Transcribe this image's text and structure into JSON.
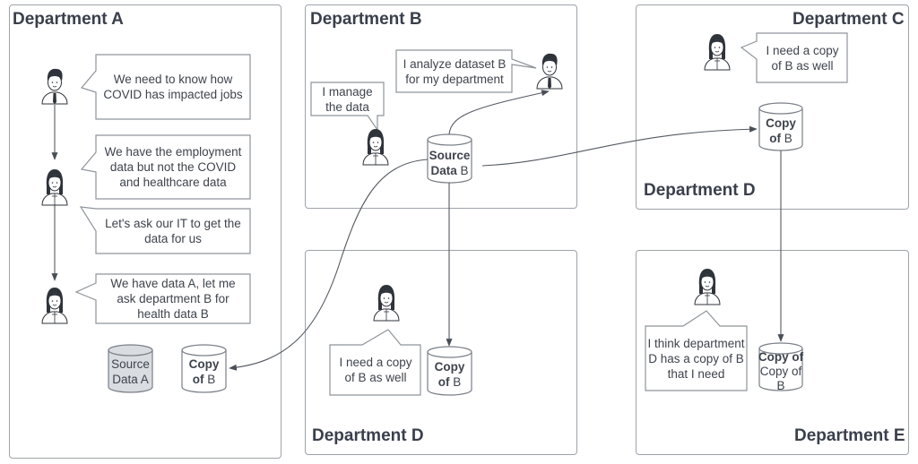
{
  "diagram": {
    "colors": {
      "stroke": "#5f646c",
      "panel_border": "#9ea3aa",
      "text": "#3a3f4b",
      "source_a_fill": "#d9dce1"
    },
    "panels": {
      "dept_a": {
        "title": "Department A"
      },
      "dept_b": {
        "title": "Department B"
      },
      "dept_d_mid": {
        "title": "Department D"
      },
      "dept_cd": {
        "title_c": "Department C",
        "title_d": "Department D"
      },
      "dept_e": {
        "title": "Department E"
      }
    },
    "bubbles": {
      "a1": "We need to know how COVID has impacted jobs",
      "a2": "We have the employment data but not the COVID and healthcare data",
      "a3": "Let's ask our IT to get the data for us",
      "a4": "We have data A, let me ask department B for health data B",
      "b_manage": "I manage the data",
      "b_analyze": "I analyze dataset B for my department",
      "c_need": "I need a copy of B as well",
      "d_need": "I need a copy of B as well",
      "e_think": "I think department D has a copy of B that I need"
    },
    "people": [
      {
        "id": "a-man",
        "type": "man",
        "panel": "Department A"
      },
      {
        "id": "a-woman-1",
        "type": "woman",
        "panel": "Department A"
      },
      {
        "id": "a-woman-2",
        "type": "woman",
        "panel": "Department A"
      },
      {
        "id": "b-woman",
        "type": "woman",
        "panel": "Department B"
      },
      {
        "id": "b-man",
        "type": "man",
        "panel": "Department B"
      },
      {
        "id": "c-woman",
        "type": "woman",
        "panel": "Department C"
      },
      {
        "id": "d-woman",
        "type": "woman",
        "panel": "Department D"
      },
      {
        "id": "e-woman",
        "type": "woman",
        "panel": "Department E"
      }
    ],
    "databases": {
      "source_a": {
        "line1": "Source",
        "line2": "Data A"
      },
      "copy_a": {
        "bold": "Copy",
        "bold2": "of",
        "normal2": "B"
      },
      "source_b": {
        "bold": "Source",
        "bold2": "Data",
        "normal2": "B"
      },
      "copy_d": {
        "bold": "Copy",
        "bold2": "of",
        "normal2": "B"
      },
      "copy_cd": {
        "bold": "Copy",
        "bold2": "of",
        "normal2": "B"
      },
      "copy_e": {
        "bold": "Copy of",
        "line2": "Copy of",
        "line3": "B"
      }
    },
    "connectors": [
      {
        "from": "a-man",
        "to": "a-woman-1"
      },
      {
        "from": "a-woman-1",
        "to": "a-woman-2"
      },
      {
        "from": "Source Data B",
        "to": "b-man"
      },
      {
        "from": "Source Data B",
        "to": "Copy of B (Department A)"
      },
      {
        "from": "Source Data B",
        "to": "Copy of B (Department D)"
      },
      {
        "from": "Source Data B",
        "to": "Copy of B (Department C/D)"
      },
      {
        "from": "Copy of B (Department C/D)",
        "to": "Copy of Copy of B (Department E)"
      }
    ]
  }
}
